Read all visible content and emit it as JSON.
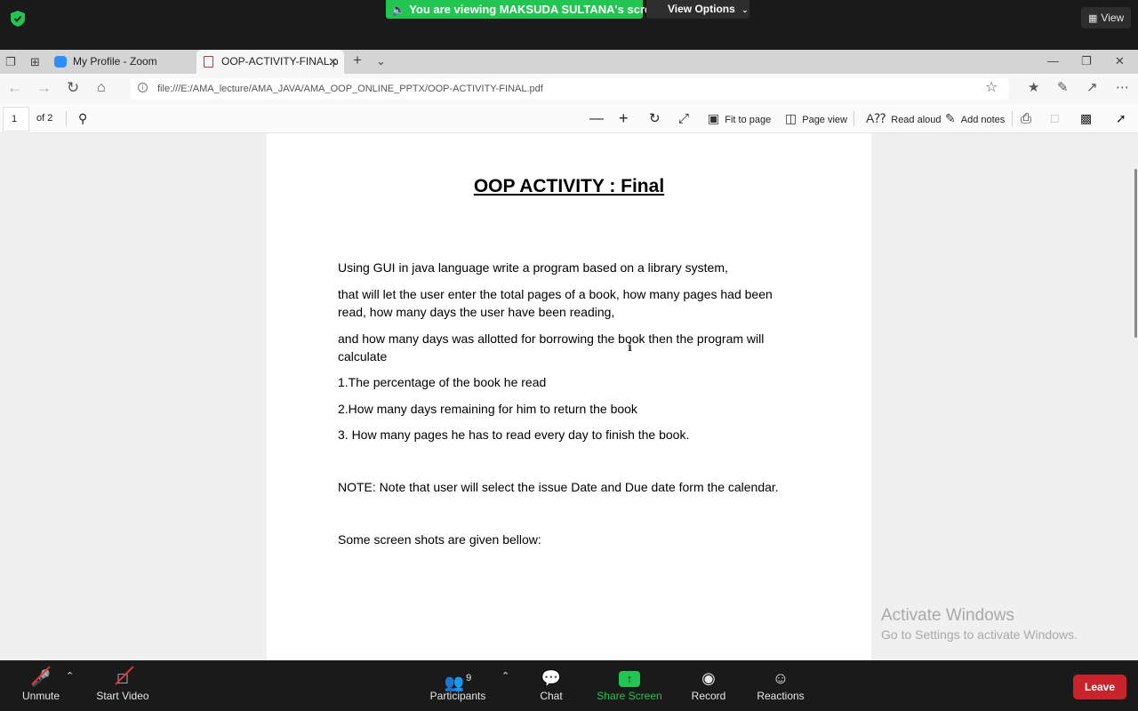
{
  "zoom_top": {
    "banner_text": "You are viewing MAKSUDA SULTANA's screen",
    "view_options_label": "View Options",
    "view_label": "View"
  },
  "browser": {
    "tabs": [
      {
        "label": "My Profile - Zoom"
      },
      {
        "label": "OOP-ACTIVITY-FINAL.p"
      }
    ],
    "url": "file:///E:/AMA_lecture/AMA_JAVA/AMA_OOP_ONLINE_PPTX/OOP-ACTIVITY-FINAL.pdf"
  },
  "pdf_toolbar": {
    "page_number": "1",
    "page_total": "of 2",
    "fit_to_page": "Fit to page",
    "page_view": "Page view",
    "read_aloud": "Read aloud",
    "add_notes": "Add notes"
  },
  "document": {
    "title": "OOP ACTIVITY  : Final",
    "paragraphs": [
      "Using GUI in java language write a program based on a library system,",
      " that will let the user enter the total pages of a book, how many pages had been read, how many days  the user have been reading,",
      " and how many days was allotted for borrowing the book then the program will calculate",
      "1.The percentage of the book he read",
      "2.How many days remaining for him to return the book",
      "3. How many pages he has to read every day to finish the book.",
      "NOTE: Note that user will select the issue Date and Due date form the calendar.",
      "Some screen shots are given bellow:"
    ]
  },
  "watermark": {
    "line1": "Activate Windows",
    "line2": "Go to Settings to activate Windows."
  },
  "zoom_bottom": {
    "unmute": "Unmute",
    "start_video": "Start Video",
    "participants": "Participants",
    "participant_count": "9",
    "chat": "Chat",
    "share_screen": "Share Screen",
    "record": "Record",
    "reactions": "Reactions",
    "leave": "Leave"
  },
  "colors": {
    "banner_green": "#23c552",
    "leave_red": "#c9242c",
    "share_green": "#23c552"
  }
}
